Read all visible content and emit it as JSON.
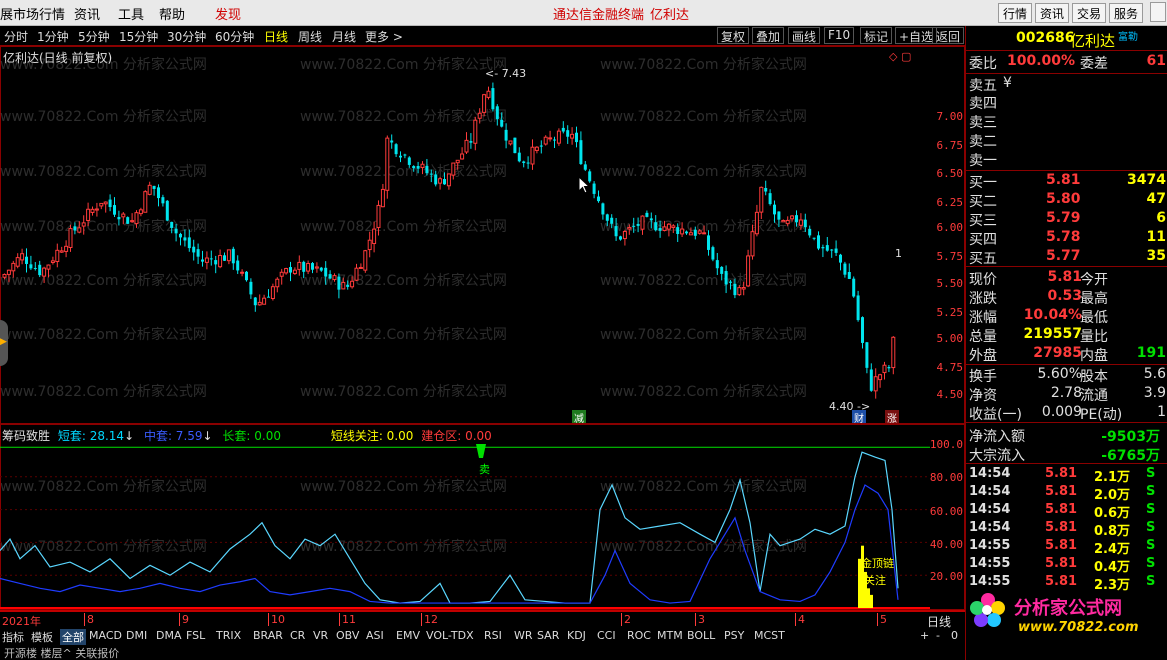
{
  "menubar": {
    "items": [
      "展市场行情",
      "资讯",
      "工具",
      "帮助",
      "发现"
    ],
    "center": [
      "通达信金融终端",
      "亿利达"
    ],
    "right_buttons": [
      "行情",
      "资讯",
      "交易",
      "服务"
    ]
  },
  "periods": [
    "分时",
    "1分钟",
    "5分钟",
    "15分钟",
    "30分钟",
    "60分钟",
    "日线",
    "周线",
    "月线",
    "更多 >"
  ],
  "active_period": "日线",
  "tools": [
    "复权",
    "叠加",
    "画线",
    "F10",
    "标记",
    "+自选",
    "返回"
  ],
  "chart": {
    "title": "亿利达(日线 前复权)",
    "high_label": "7.43",
    "low_label": "4.40",
    "marker_jian": "减",
    "marker_cai": "财",
    "marker_zhang": "涨",
    "y_ticks": [
      "7.00",
      "6.75",
      "6.50",
      "6.25",
      "6.00",
      "5.75",
      "5.50",
      "5.25",
      "5.00",
      "4.75",
      "4.50"
    ],
    "side_mark": "1"
  },
  "indicator": {
    "name": "筹码致胜",
    "short_label": "短套: 28.14",
    "mid_label": "中套: 7.59",
    "long_label": "长套: 0.00",
    "focus_label": "短线关注: 0.00",
    "build_label": "建仓区: 0.00",
    "sell_mark": "卖",
    "top_mark": "金顶链",
    "watch_mark": "关注",
    "y_ticks": [
      "100.0",
      "80.00",
      "60.00",
      "40.00",
      "20.00"
    ]
  },
  "time_axis": [
    "2021年",
    "8",
    "9",
    "10",
    "11",
    "12",
    "2",
    "3",
    "4",
    "5"
  ],
  "bottom_right": "日线",
  "index_tabs": [
    "指标",
    "模板",
    "全部",
    "MACD",
    "DMI",
    "DMA",
    "FSL",
    "TRIX",
    "BRAR",
    "CR",
    "VR",
    "OBV",
    "ASI",
    "EMV",
    "VOL-TDX",
    "RSI",
    "WR",
    "SAR",
    "KDJ",
    "CCI",
    "ROC",
    "MTM",
    "BOLL",
    "PSY",
    "MCST"
  ],
  "index_selected": "全部",
  "status_partial": "开源楼  楼层^  关联报价",
  "watermark": "www.70822.Com 分析家公式网",
  "logo": {
    "name": "分析家公式网",
    "url": "www.70822.com"
  },
  "quote": {
    "code": "002686",
    "name": "亿利达",
    "badge": "富勒",
    "weibi_label": "委比",
    "weibi": "100.00%",
    "weicha_label": "委差",
    "weicha": "61",
    "sell_levels": [
      "卖五",
      "卖四",
      "卖三",
      "卖二",
      "卖一"
    ],
    "sell_unit": "¥",
    "buy_levels": [
      {
        "label": "买一",
        "price": "5.81",
        "vol": "3474"
      },
      {
        "label": "买二",
        "price": "5.80",
        "vol": "47"
      },
      {
        "label": "买三",
        "price": "5.79",
        "vol": "6"
      },
      {
        "label": "买四",
        "price": "5.78",
        "vol": "11"
      },
      {
        "label": "买五",
        "price": "5.77",
        "vol": "35"
      }
    ],
    "stats": [
      {
        "k1": "现价",
        "v1": "5.81",
        "k2": "今开",
        "v2": ""
      },
      {
        "k1": "涨跌",
        "v1": "0.53",
        "k2": "最高",
        "v2": ""
      },
      {
        "k1": "涨幅",
        "v1": "10.04%",
        "k2": "最低",
        "v2": ""
      },
      {
        "k1": "总量",
        "v1": "219557",
        "k2": "量比",
        "v2": ""
      },
      {
        "k1": "外盘",
        "v1": "27985",
        "k2": "内盘",
        "v2": "191"
      }
    ],
    "stats2": [
      {
        "k1": "换手",
        "v1": "5.60%",
        "k2": "股本",
        "v2": "5.6"
      },
      {
        "k1": "净资",
        "v1": "2.78",
        "k2": "流通",
        "v2": "3.9"
      },
      {
        "k1": "收益(一)",
        "v1": "0.009",
        "k2": "PE(动)",
        "v2": "1"
      }
    ],
    "flows": [
      {
        "k": "净流入额",
        "v": "-9503万"
      },
      {
        "k": "大宗流入",
        "v": "-6765万"
      }
    ],
    "ticks": [
      {
        "t": "14:54",
        "p": "5.81",
        "v": "2.1万",
        "s": "S"
      },
      {
        "t": "14:54",
        "p": "5.81",
        "v": "2.0万",
        "s": "S"
      },
      {
        "t": "14:54",
        "p": "5.81",
        "v": "0.6万",
        "s": "S"
      },
      {
        "t": "14:54",
        "p": "5.81",
        "v": "0.8万",
        "s": "S"
      },
      {
        "t": "14:55",
        "p": "5.81",
        "v": "2.4万",
        "s": "S"
      },
      {
        "t": "14:55",
        "p": "5.81",
        "v": "0.4万",
        "s": "S"
      },
      {
        "t": "14:55",
        "p": "5.81",
        "v": "2.3万",
        "s": "S"
      }
    ]
  },
  "colors": {
    "up": "#ff3b3b",
    "down": "#00e5ee",
    "frame": "#8a0000",
    "accent": "#ffff00"
  }
}
